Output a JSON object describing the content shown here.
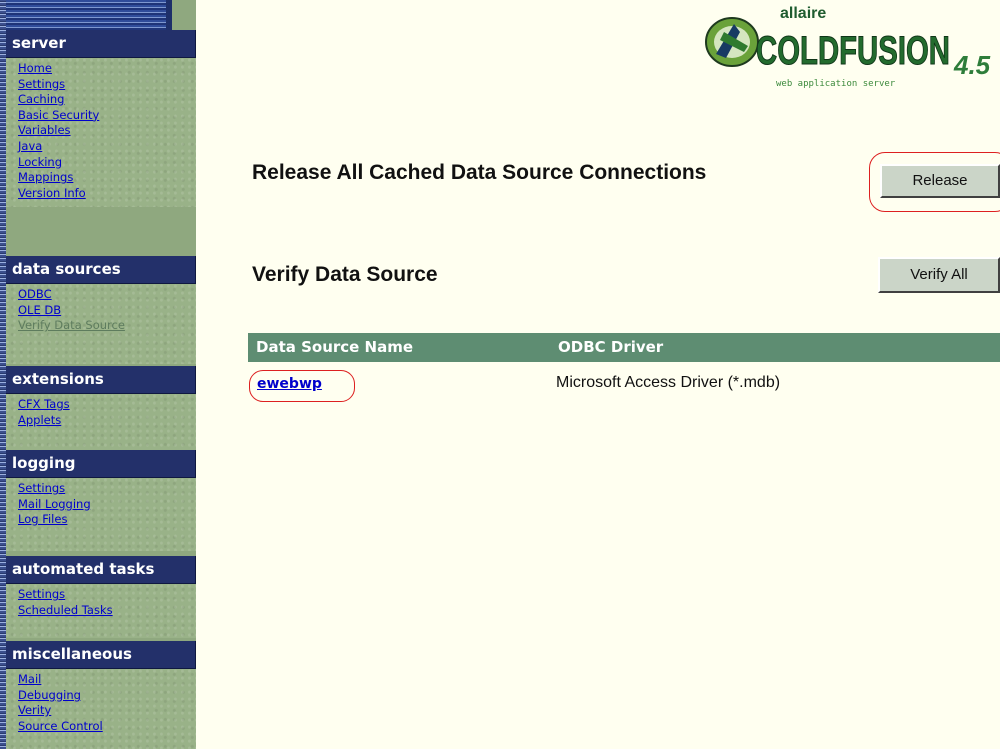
{
  "logo": {
    "brand_small": "allaire",
    "brand_main": "COLDFUSION",
    "version": "4.5",
    "tagline": "web application server"
  },
  "sidebar": {
    "sections": [
      {
        "title": "server",
        "items": [
          "Home",
          "Settings",
          "Caching",
          "Basic Security",
          "Variables",
          "Java",
          "Locking",
          "Mappings",
          "Version Info"
        ]
      },
      {
        "title": "data sources",
        "items": [
          "ODBC",
          "OLE DB",
          "Verify Data Source"
        ],
        "current": "Verify Data Source"
      },
      {
        "title": "extensions",
        "items": [
          "CFX Tags",
          "Applets"
        ]
      },
      {
        "title": "logging",
        "items": [
          "Settings",
          "Mail Logging",
          "Log Files"
        ]
      },
      {
        "title": "automated tasks",
        "items": [
          "Settings",
          "Scheduled Tasks"
        ]
      },
      {
        "title": "miscellaneous",
        "items": [
          "Mail",
          "Debugging",
          "Verity",
          "Source Control"
        ]
      }
    ]
  },
  "main": {
    "release_heading": "Release All Cached Data Source Connections",
    "release_button": "Release",
    "verify_heading": "Verify Data Source",
    "verify_all_button": "Verify All",
    "table": {
      "columns": [
        "Data Source Name",
        "ODBC Driver"
      ],
      "rows": [
        {
          "name": "ewebwp",
          "driver": "Microsoft Access Driver (*.mdb)"
        }
      ]
    }
  },
  "colors": {
    "page_bg": "#fffff0",
    "sidebar_bg": "#99b288",
    "nav_header_bg": "#23306a",
    "link": "#0000cc",
    "table_header_bg": "#5e8d72",
    "highlight_ring": "#dd2020"
  }
}
